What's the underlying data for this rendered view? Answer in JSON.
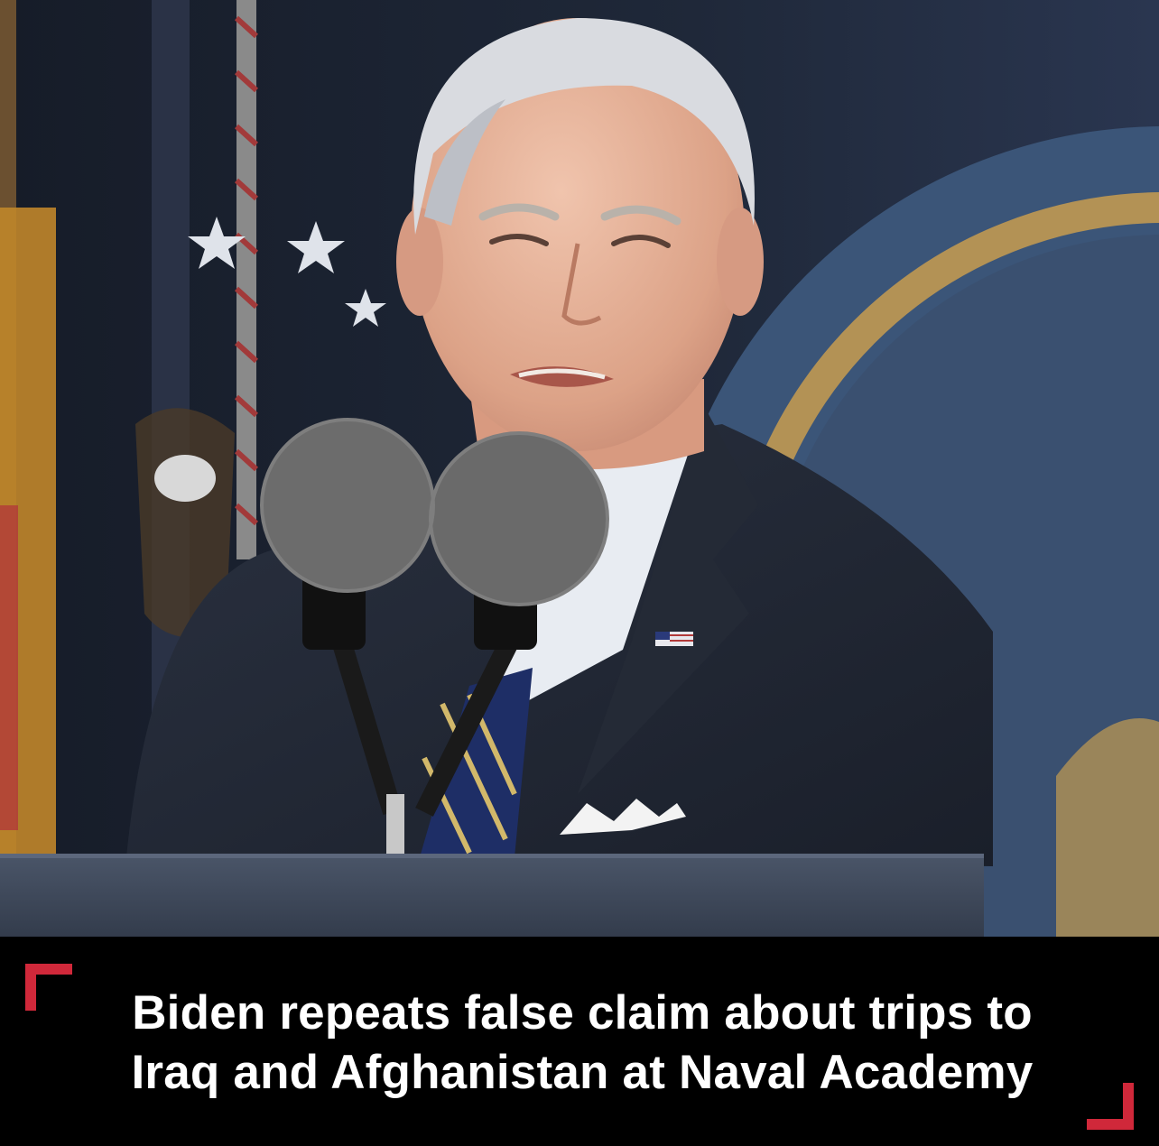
{
  "headline": {
    "line1": "Biden repeats false claim about trips to",
    "line2": "Iraq and Afghanistan at Naval Academy"
  },
  "colors": {
    "background": "#000000",
    "headline_text": "#ffffff",
    "bracket_accent": "#d0283a",
    "backdrop_navy": "#1c2434",
    "seal_blue": "#3b5578",
    "seal_gold": "#b39255"
  },
  "icons": {
    "top_left_corner": "corner-bracket-icon",
    "bottom_right_corner": "corner-bracket-icon"
  }
}
